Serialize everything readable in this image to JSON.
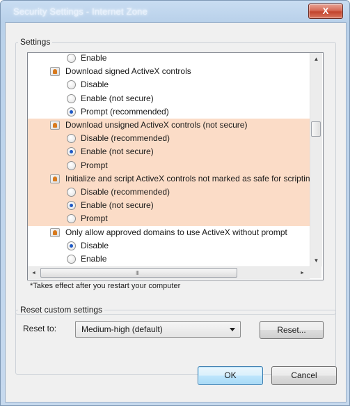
{
  "window": {
    "title": "Security Settings - Internet Zone",
    "close_label": "X"
  },
  "settings_group": {
    "label": "Settings",
    "tree": [
      {
        "kind": "option",
        "label": "Enable",
        "selected": false
      },
      {
        "kind": "category",
        "label": "Download signed ActiveX controls"
      },
      {
        "kind": "option",
        "label": "Disable",
        "selected": false
      },
      {
        "kind": "option",
        "label": "Enable (not secure)",
        "selected": false
      },
      {
        "kind": "option",
        "label": "Prompt (recommended)",
        "selected": true
      },
      {
        "kind": "category",
        "label": "Download unsigned ActiveX controls (not secure)",
        "highlighted": true
      },
      {
        "kind": "option",
        "label": "Disable (recommended)",
        "selected": false,
        "highlighted": true
      },
      {
        "kind": "option",
        "label": "Enable (not secure)",
        "selected": true,
        "highlighted": true
      },
      {
        "kind": "option",
        "label": "Prompt",
        "selected": false,
        "highlighted": true
      },
      {
        "kind": "category",
        "label": "Initialize and script ActiveX controls not marked as safe for scripting (not secure)",
        "highlighted": true
      },
      {
        "kind": "option",
        "label": "Disable (recommended)",
        "selected": false,
        "highlighted": true
      },
      {
        "kind": "option",
        "label": "Enable (not secure)",
        "selected": true,
        "highlighted": true
      },
      {
        "kind": "option",
        "label": "Prompt",
        "selected": false,
        "highlighted": true
      },
      {
        "kind": "category",
        "label": "Only allow approved domains to use ActiveX without prompt"
      },
      {
        "kind": "option",
        "label": "Disable",
        "selected": true
      },
      {
        "kind": "option",
        "label": "Enable",
        "selected": false
      }
    ],
    "scrollbar": {
      "up_glyph": "▲",
      "down_glyph": "▼",
      "left_glyph": "◄",
      "right_glyph": "►",
      "grip_glyph": "III"
    },
    "note": "*Takes effect after you restart your computer"
  },
  "reset_group": {
    "label": "Reset custom settings",
    "reset_to_label": "Reset to:",
    "level_value": "Medium-high (default)",
    "reset_button": "Reset..."
  },
  "buttons": {
    "ok": "OK",
    "cancel": "Cancel"
  },
  "colors": {
    "highlight": "#fbdcc7",
    "selected_radio": "#1e59c5"
  }
}
